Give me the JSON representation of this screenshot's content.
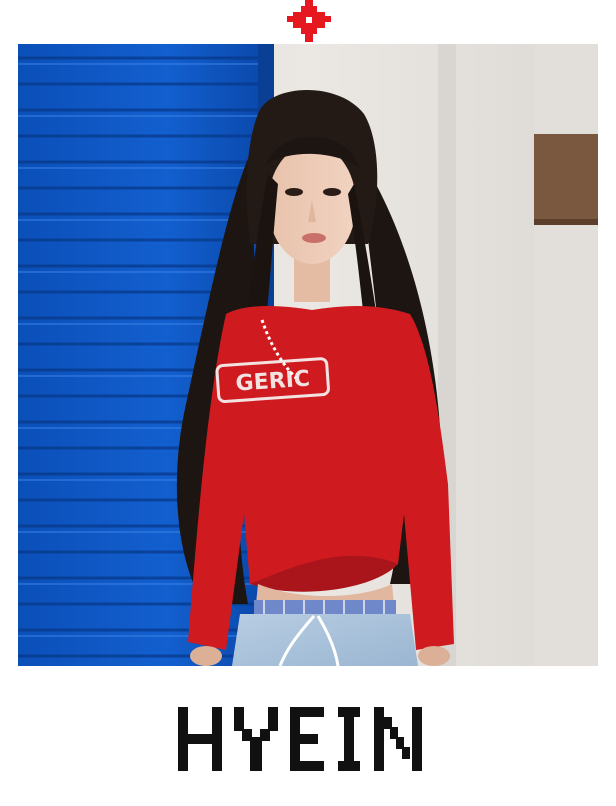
{
  "card": {
    "name": "HYEIN",
    "accent_color": "#e5171f",
    "icon": "red-pixel-cross-icon"
  },
  "photo": {
    "subject": "portrait-photo",
    "shirt_text": "GERIC"
  }
}
